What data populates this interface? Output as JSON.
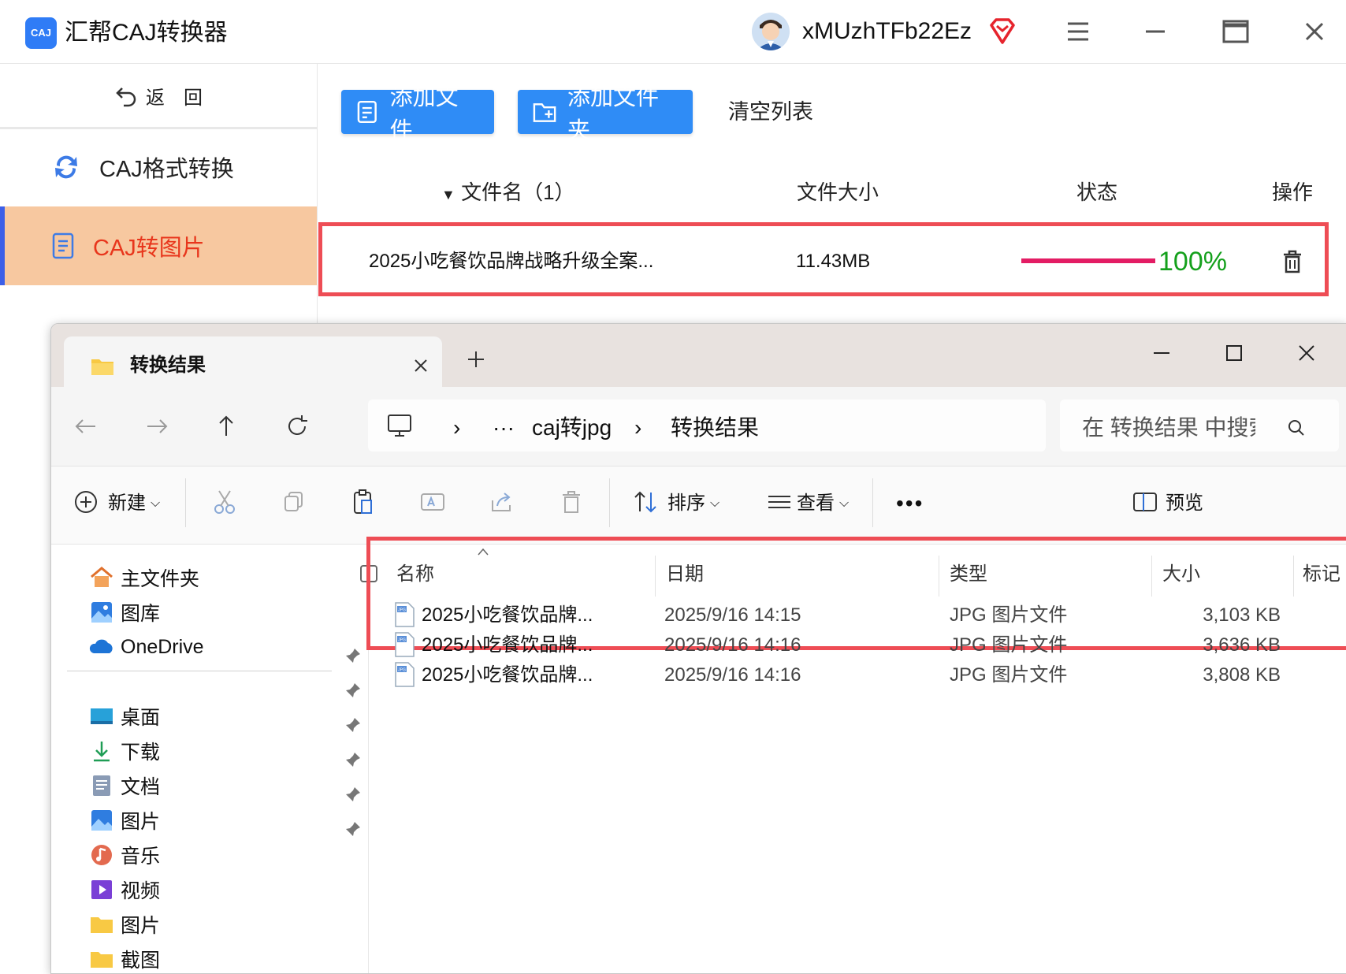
{
  "app": {
    "title": "汇帮CAJ转换器",
    "logo_text": "CAJ",
    "username": "xMUzhTFb22Ez",
    "back_label": "返　回",
    "nav": [
      {
        "label": "CAJ格式转换"
      },
      {
        "label": "CAJ转图片"
      }
    ],
    "toolbar": {
      "add_file": "添加文件",
      "add_folder": "添加文件夹",
      "clear_list": "清空列表"
    },
    "table_headers": {
      "name": "文件名（1）",
      "size": "文件大小",
      "status": "状态",
      "operation": "操作"
    },
    "rows": [
      {
        "name": "2025小吃餐饮品牌战略升级全案...",
        "size": "11.43MB",
        "progress_text": "100%",
        "progress": 1.0
      }
    ],
    "colors": {
      "accent": "#2f8cf6",
      "active_nav_bg": "#f7c8a0",
      "active_nav_text": "#e8361c",
      "progress": "#e31c64",
      "progress_text": "#14a01c",
      "highlight": "#ee4d55"
    }
  },
  "explorer": {
    "tab_title": "转换结果",
    "breadcrumb": [
      "caj转jpg",
      "转换结果"
    ],
    "search_placeholder": "在 转换结果 中搜索",
    "commands": {
      "new": "新建",
      "sort": "排序",
      "view": "查看",
      "preview": "预览"
    },
    "nav_pane": {
      "top": [
        "主文件夹",
        "图库",
        "OneDrive"
      ],
      "pinned": [
        "桌面",
        "下载",
        "文档",
        "图片",
        "音乐",
        "视频"
      ],
      "other": [
        "图片",
        "截图"
      ]
    },
    "columns": {
      "name": "名称",
      "date": "日期",
      "type": "类型",
      "size": "大小",
      "tags": "标记"
    },
    "files": [
      {
        "name": "2025小吃餐饮品牌...",
        "date": "2025/9/16 14:15",
        "type": "JPG 图片文件",
        "size": "3,103 KB"
      },
      {
        "name": "2025小吃餐饮品牌...",
        "date": "2025/9/16 14:16",
        "type": "JPG 图片文件",
        "size": "3,636 KB"
      },
      {
        "name": "2025小吃餐饮品牌...",
        "date": "2025/9/16 14:16",
        "type": "JPG 图片文件",
        "size": "3,808 KB"
      }
    ]
  }
}
